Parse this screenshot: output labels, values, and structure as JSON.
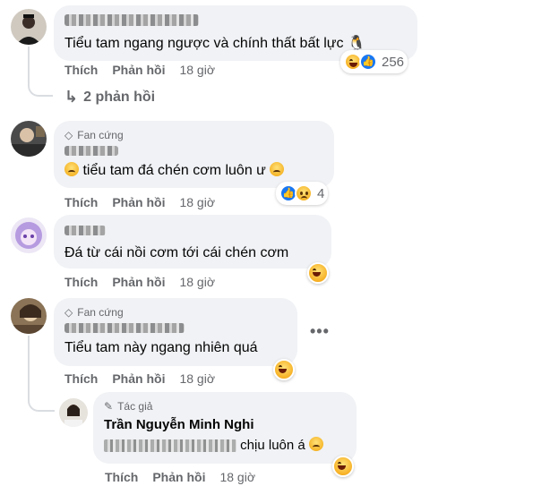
{
  "comments": [
    {
      "text": "Tiểu tam ngang ngược và chính thất bất lực",
      "trailing_emoji": "🐧",
      "actions": {
        "like": "Thích",
        "reply": "Phản hồi",
        "time": "18 giờ"
      },
      "reaction_count": "256",
      "replies_link": "2 phản hồi"
    },
    {
      "badge": "Fan cứng",
      "text": "tiểu tam đá chén cơm luôn ư",
      "actions": {
        "like": "Thích",
        "reply": "Phản hồi",
        "time": "18 giờ"
      },
      "reaction_count": "4"
    },
    {
      "text": "Đá từ cái nồi cơm tới cái chén cơm",
      "actions": {
        "like": "Thích",
        "reply": "Phản hồi",
        "time": "18 giờ"
      }
    },
    {
      "badge": "Fan cứng",
      "text": "Tiểu tam này ngang nhiên quá",
      "more_label": "•••",
      "actions": {
        "like": "Thích",
        "reply": "Phản hồi",
        "time": "18 giờ"
      }
    }
  ],
  "reply": {
    "badge": "Tác giả",
    "author": "Trần Nguyễn Minh Nghi",
    "text_suffix": "chịu luôn á",
    "actions": {
      "like": "Thích",
      "reply": "Phản hồi",
      "time": "18 giờ"
    }
  },
  "colors": {
    "bubble": "#f0f2f5",
    "meta": "#65676b",
    "like_blue": "#1877f2",
    "text": "#050505"
  },
  "icons": {
    "badge_fan": "diamond-icon",
    "badge_author": "pencil-icon",
    "reply_arrow": "reply-arrow-icon"
  }
}
